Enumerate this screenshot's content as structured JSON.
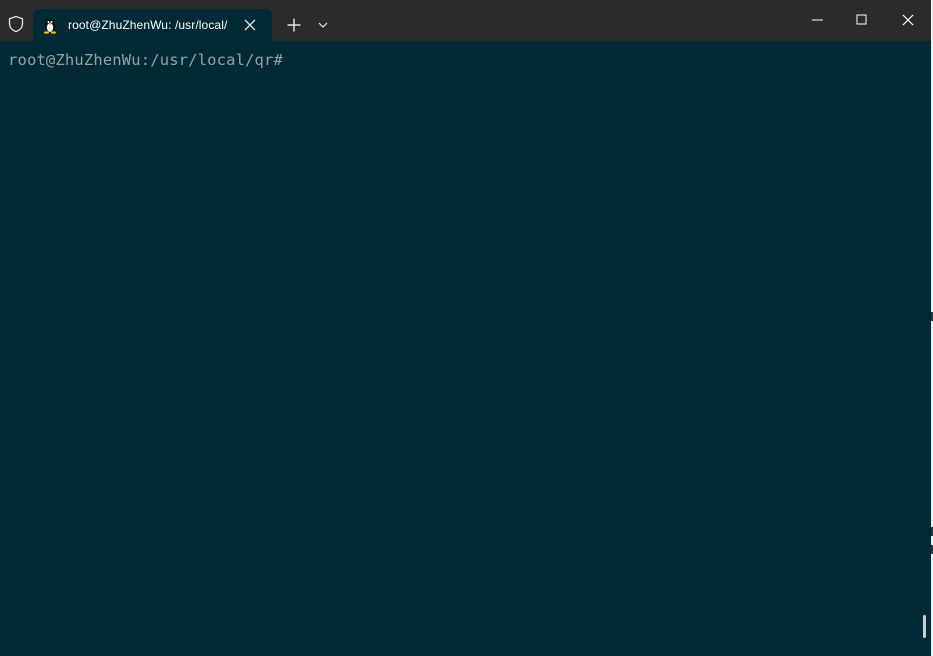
{
  "titlebar": {
    "tab": {
      "title": "root@ZhuZhenWu: /usr/local/",
      "icon": "linux-penguin-icon",
      "close_icon": "close-icon"
    },
    "new_tab_icon": "plus-icon",
    "dropdown_icon": "chevron-down-icon",
    "shield_icon": "shield-icon",
    "window_controls": [
      "minimize-icon",
      "maximize-icon",
      "close-icon"
    ]
  },
  "terminal": {
    "prompt": "root@ZhuZhenWu:/usr/local/qr#"
  },
  "colors": {
    "terminal_background": "#002b36",
    "titlebar_background": "#2b2b2b",
    "prompt_text": "#93a1a1"
  }
}
